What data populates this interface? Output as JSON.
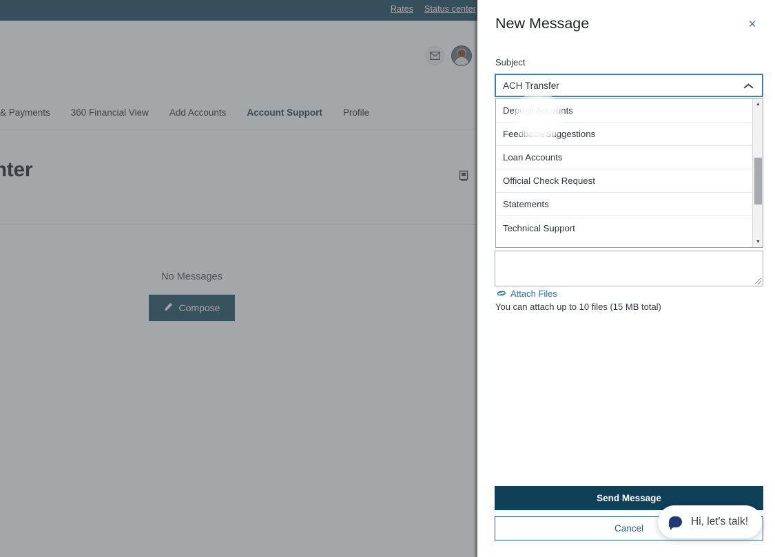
{
  "background": {
    "topbar": {
      "links": [
        {
          "label": "Rates"
        },
        {
          "label": "Status center"
        }
      ]
    },
    "nav": {
      "items": [
        {
          "label": "& Payments",
          "active": false
        },
        {
          "label": "360 Financial View",
          "active": false
        },
        {
          "label": "Add Accounts",
          "active": false
        },
        {
          "label": "Account Support",
          "active": true
        },
        {
          "label": "Profile",
          "active": false
        }
      ]
    },
    "page_title": "Center",
    "empty_state": {
      "text": "No Messages",
      "compose_label": "Compose"
    },
    "icons": {
      "mail": "mail-icon",
      "avatar": "avatar",
      "archive": "archive-icon"
    }
  },
  "panel": {
    "title": "New Message",
    "close_label": "×",
    "subject": {
      "label": "Subject",
      "value": "ACH Transfer",
      "expanded": true,
      "options": [
        "Deposit Accounts",
        "Feedback/Suggestions",
        "Loan Accounts",
        "Official Check Request",
        "Statements",
        "Technical Support"
      ]
    },
    "body": {
      "value": "",
      "placeholder": ""
    },
    "attach": {
      "link_label": "Attach Files",
      "note": "You can attach up to 10 files (15 MB total)"
    },
    "actions": {
      "send_label": "Send Message",
      "cancel_label": "Cancel"
    }
  },
  "chat_widget": {
    "text": "Hi, let's talk!"
  },
  "colors": {
    "brand_navy": "#0e4057",
    "topbar_navy": "#0e3a52",
    "link_blue": "#2f6aa8",
    "focus_blue": "#3c7cb8",
    "scrim": "rgba(90,95,99,.55)"
  }
}
